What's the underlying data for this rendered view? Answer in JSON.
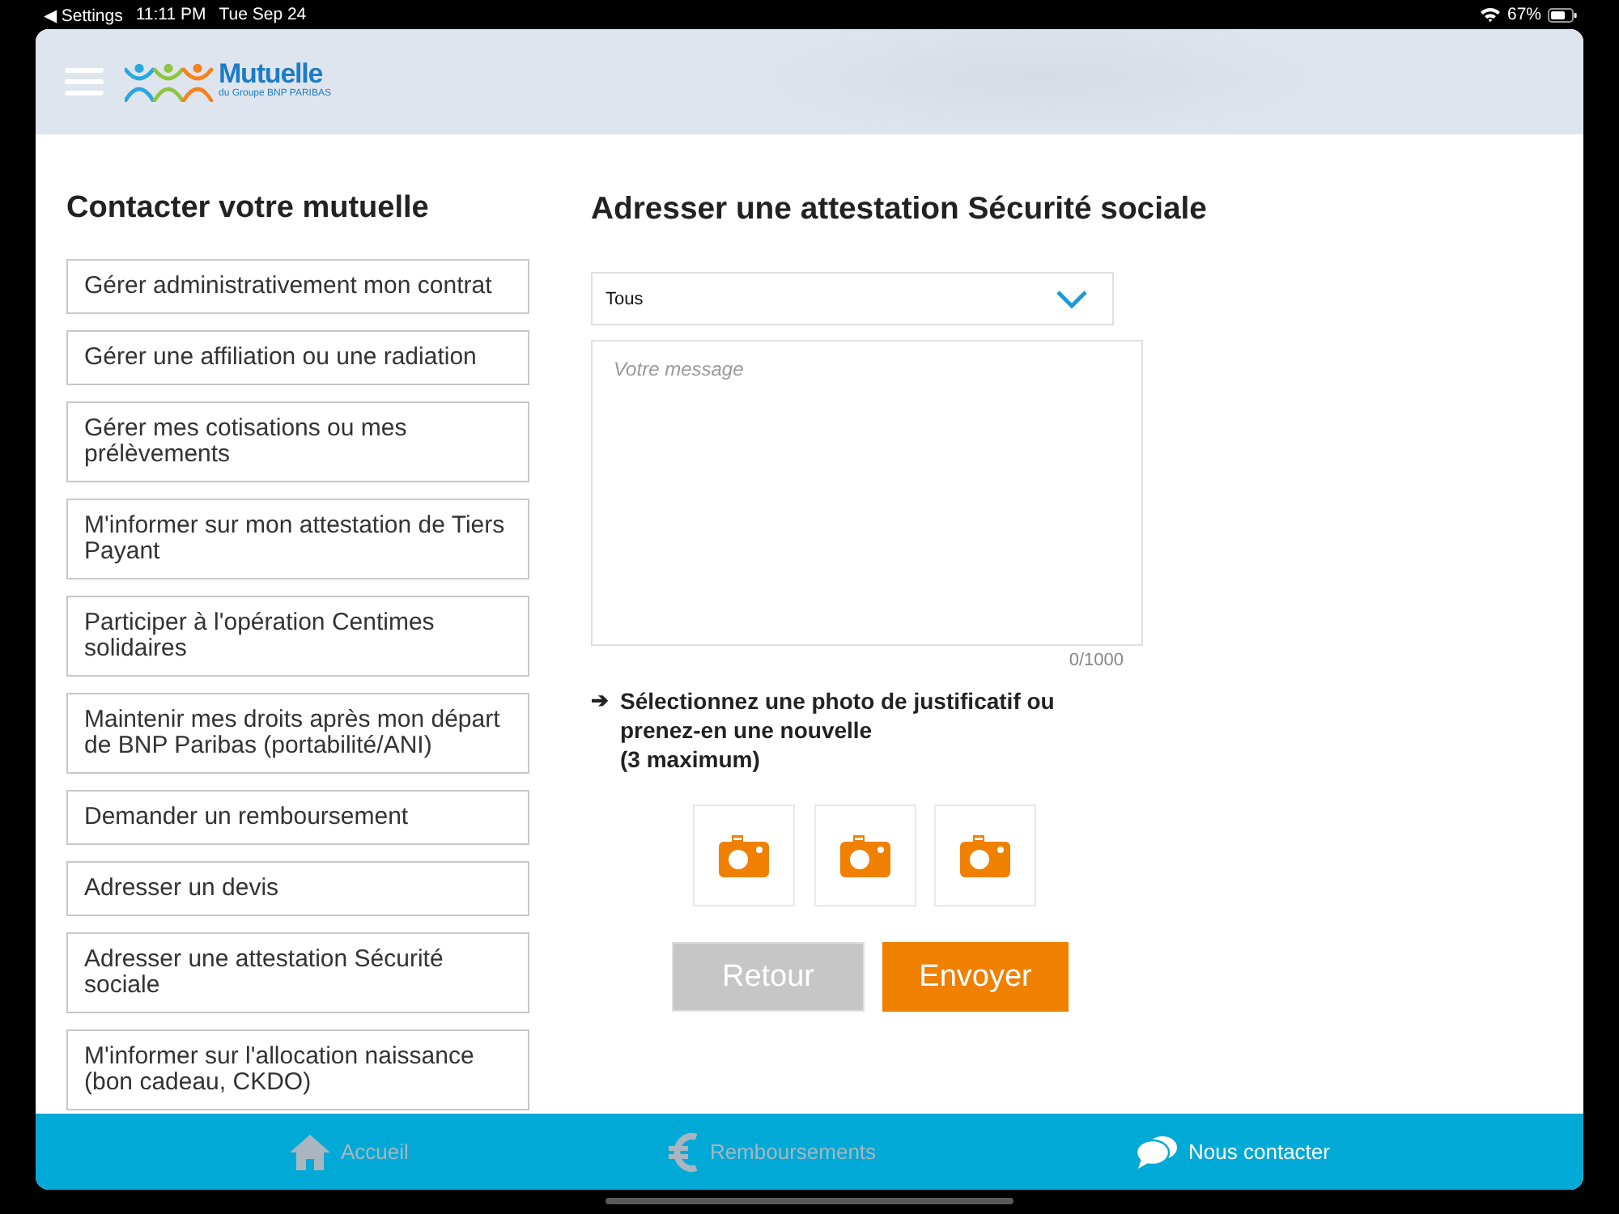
{
  "status_bar": {
    "back_link": "◀ Settings",
    "time": "11:11 PM",
    "date": "Tue Sep 24",
    "battery": "67%"
  },
  "header": {
    "logo": {
      "name": "Mutuelle",
      "tagline": "du Groupe BNP PARIBAS"
    }
  },
  "sidebar": {
    "title": "Contacter votre mutuelle",
    "items": [
      {
        "label": "Gérer administrativement mon contrat"
      },
      {
        "label": "Gérer une affiliation ou une radiation"
      },
      {
        "label": "Gérer mes cotisations ou mes prélèvements"
      },
      {
        "label": "M'informer sur mon attestation de Tiers Payant"
      },
      {
        "label": "Participer à l'opération Centimes solidaires"
      },
      {
        "label": "Maintenir mes droits après mon départ de BNP Paribas (portabilité/ANI)"
      },
      {
        "label": "Demander un remboursement"
      },
      {
        "label": "Adresser un devis"
      },
      {
        "label": "Adresser une attestation Sécurité sociale"
      },
      {
        "label": "M'informer sur l'allocation naissance (bon cadeau, CKDO)"
      }
    ]
  },
  "form": {
    "title": "Adresser une attestation Sécurité sociale",
    "category_select": {
      "value": "Tous"
    },
    "message": {
      "placeholder": "Votre message",
      "counter": "0/1000"
    },
    "photo_hint": {
      "arrow": "➔",
      "text": "Sélectionnez une photo de justificatif ou prenez-en une nouvelle",
      "note": "(3 maximum)"
    },
    "photo_slots": [
      {
        "kind": "empty"
      },
      {
        "kind": "empty"
      },
      {
        "kind": "empty"
      }
    ],
    "buttons": [
      {
        "label": "Retour",
        "kind": "secondary"
      },
      {
        "label": "Envoyer",
        "kind": "primary"
      }
    ]
  },
  "tab_bar": {
    "items": [
      {
        "label": "Accueil",
        "selected": false
      },
      {
        "label": "Remboursements",
        "selected": false
      },
      {
        "label": "Nous contacter",
        "selected": true
      }
    ]
  }
}
